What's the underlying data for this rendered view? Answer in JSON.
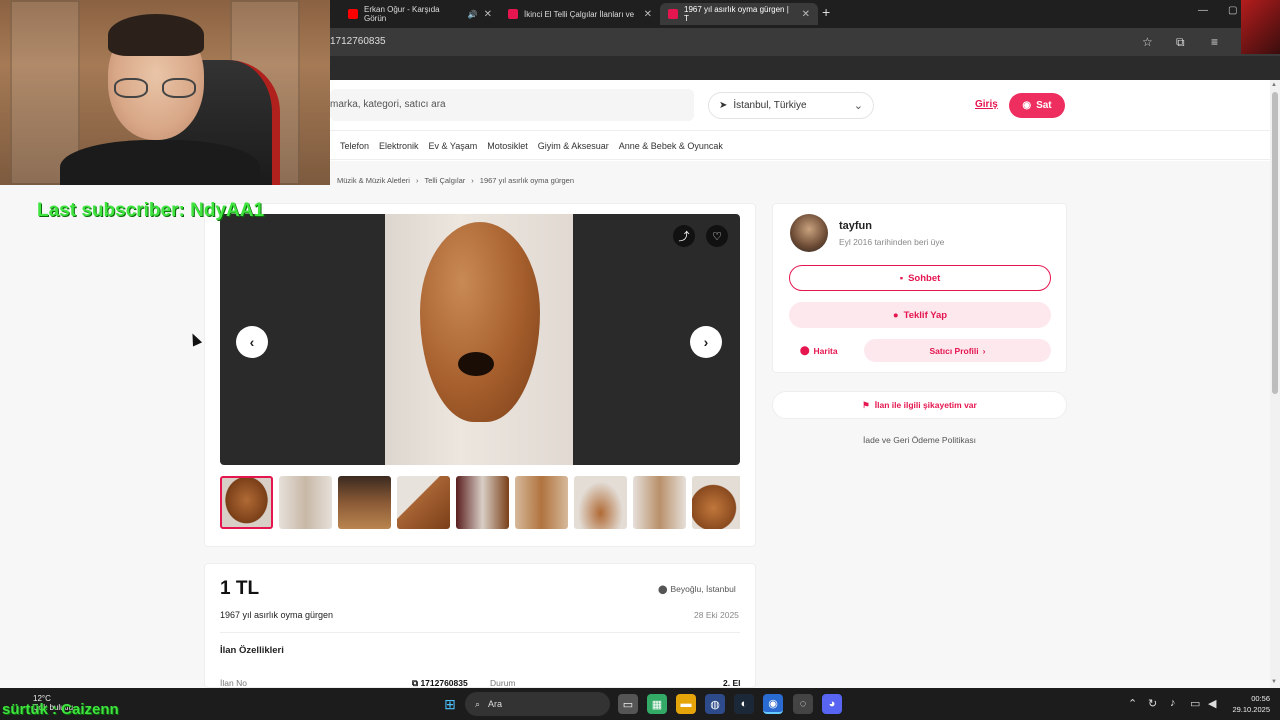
{
  "browser": {
    "tabs": [
      {
        "label": "Erkan Oğur - Karşıda Görün",
        "color": "#ff0000",
        "audio": "🔊"
      },
      {
        "label": "İkinci El Telli Çalgılar İlanları ve",
        "color": "#e5164f"
      },
      {
        "label": "1967 yıl asırlık oyma gürgen | T",
        "color": "#e5164f"
      }
    ],
    "new_tab": "+",
    "url": "1712760835"
  },
  "header": {
    "search_placeholder": "marka, kategori, satıcı ara",
    "location": "İstanbul, Türkiye",
    "login": "Giriş",
    "sell": "Sat"
  },
  "categories": [
    "Telefon",
    "Elektronik",
    "Ev & Yaşam",
    "Motosiklet",
    "Giyim & Aksesuar",
    "Anne & Bebek & Oyuncak"
  ],
  "breadcrumb": [
    "Müzik & Müzik Aletleri",
    "Telli Çalgılar",
    "1967 yıl asırlık oyma gürgen"
  ],
  "seller": {
    "name": "tayfun",
    "since": "Eyl 2016 tarihinden beri üye",
    "chat": "Sohbet",
    "offer": "Teklif Yap",
    "map": "Harita",
    "profile": "Satıcı Profili"
  },
  "report": "İlan ile ilgili şikayetim var",
  "refund": "İade ve Geri Ödeme Politikası",
  "listing": {
    "price": "1 TL",
    "location": "Beyoğlu, İstanbul",
    "title": "1967 yıl asırlık oyma gürgen",
    "date": "28 Eki 2025",
    "features_title": "İlan Özellikleri",
    "id_label": "İlan No",
    "id_value": "1712760835",
    "condition_label": "Durum",
    "condition_value": "2. El"
  },
  "overlay": {
    "subscriber": "Last subscriber: NdyAA1",
    "follower": "sürtük : Caizenn"
  },
  "taskbar": {
    "temperature": "12°C",
    "weather_text": "Çok bulutlu",
    "search": "Ara",
    "time": "00:56",
    "date": "29.10.2025"
  }
}
